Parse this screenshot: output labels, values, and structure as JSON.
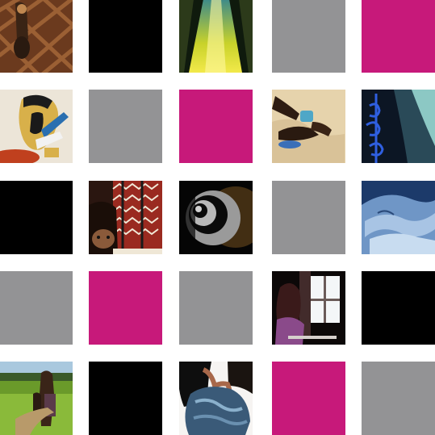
{
  "colors": {
    "background": "#ffffff",
    "black": "#000000",
    "gray": "#939395",
    "pink": "#c7197a"
  },
  "tiles": [
    {
      "kind": "photo",
      "subject": "carved-door-knocker"
    },
    {
      "kind": "solid",
      "color": "black"
    },
    {
      "kind": "photo",
      "subject": "yellow-green-light-columns"
    },
    {
      "kind": "solid",
      "color": "gray"
    },
    {
      "kind": "solid",
      "color": "pink"
    },
    {
      "kind": "photo",
      "subject": "che-guevara-painting"
    },
    {
      "kind": "solid",
      "color": "gray"
    },
    {
      "kind": "solid",
      "color": "pink"
    },
    {
      "kind": "photo",
      "subject": "hands-with-blue-objects"
    },
    {
      "kind": "photo",
      "subject": "blue-ironwork-window"
    },
    {
      "kind": "solid",
      "color": "black"
    },
    {
      "kind": "photo",
      "subject": "child-behind-woven-textile"
    },
    {
      "kind": "photo",
      "subject": "spiral-shell"
    },
    {
      "kind": "solid",
      "color": "gray"
    },
    {
      "kind": "photo",
      "subject": "blue-fabric-folds"
    },
    {
      "kind": "solid",
      "color": "gray"
    },
    {
      "kind": "solid",
      "color": "pink"
    },
    {
      "kind": "solid",
      "color": "gray"
    },
    {
      "kind": "photo",
      "subject": "woman-at-window"
    },
    {
      "kind": "solid",
      "color": "black"
    },
    {
      "kind": "photo",
      "subject": "people-in-field"
    },
    {
      "kind": "solid",
      "color": "black"
    },
    {
      "kind": "photo",
      "subject": "person-with-denim-jacket"
    },
    {
      "kind": "solid",
      "color": "pink"
    },
    {
      "kind": "solid",
      "color": "gray"
    }
  ]
}
